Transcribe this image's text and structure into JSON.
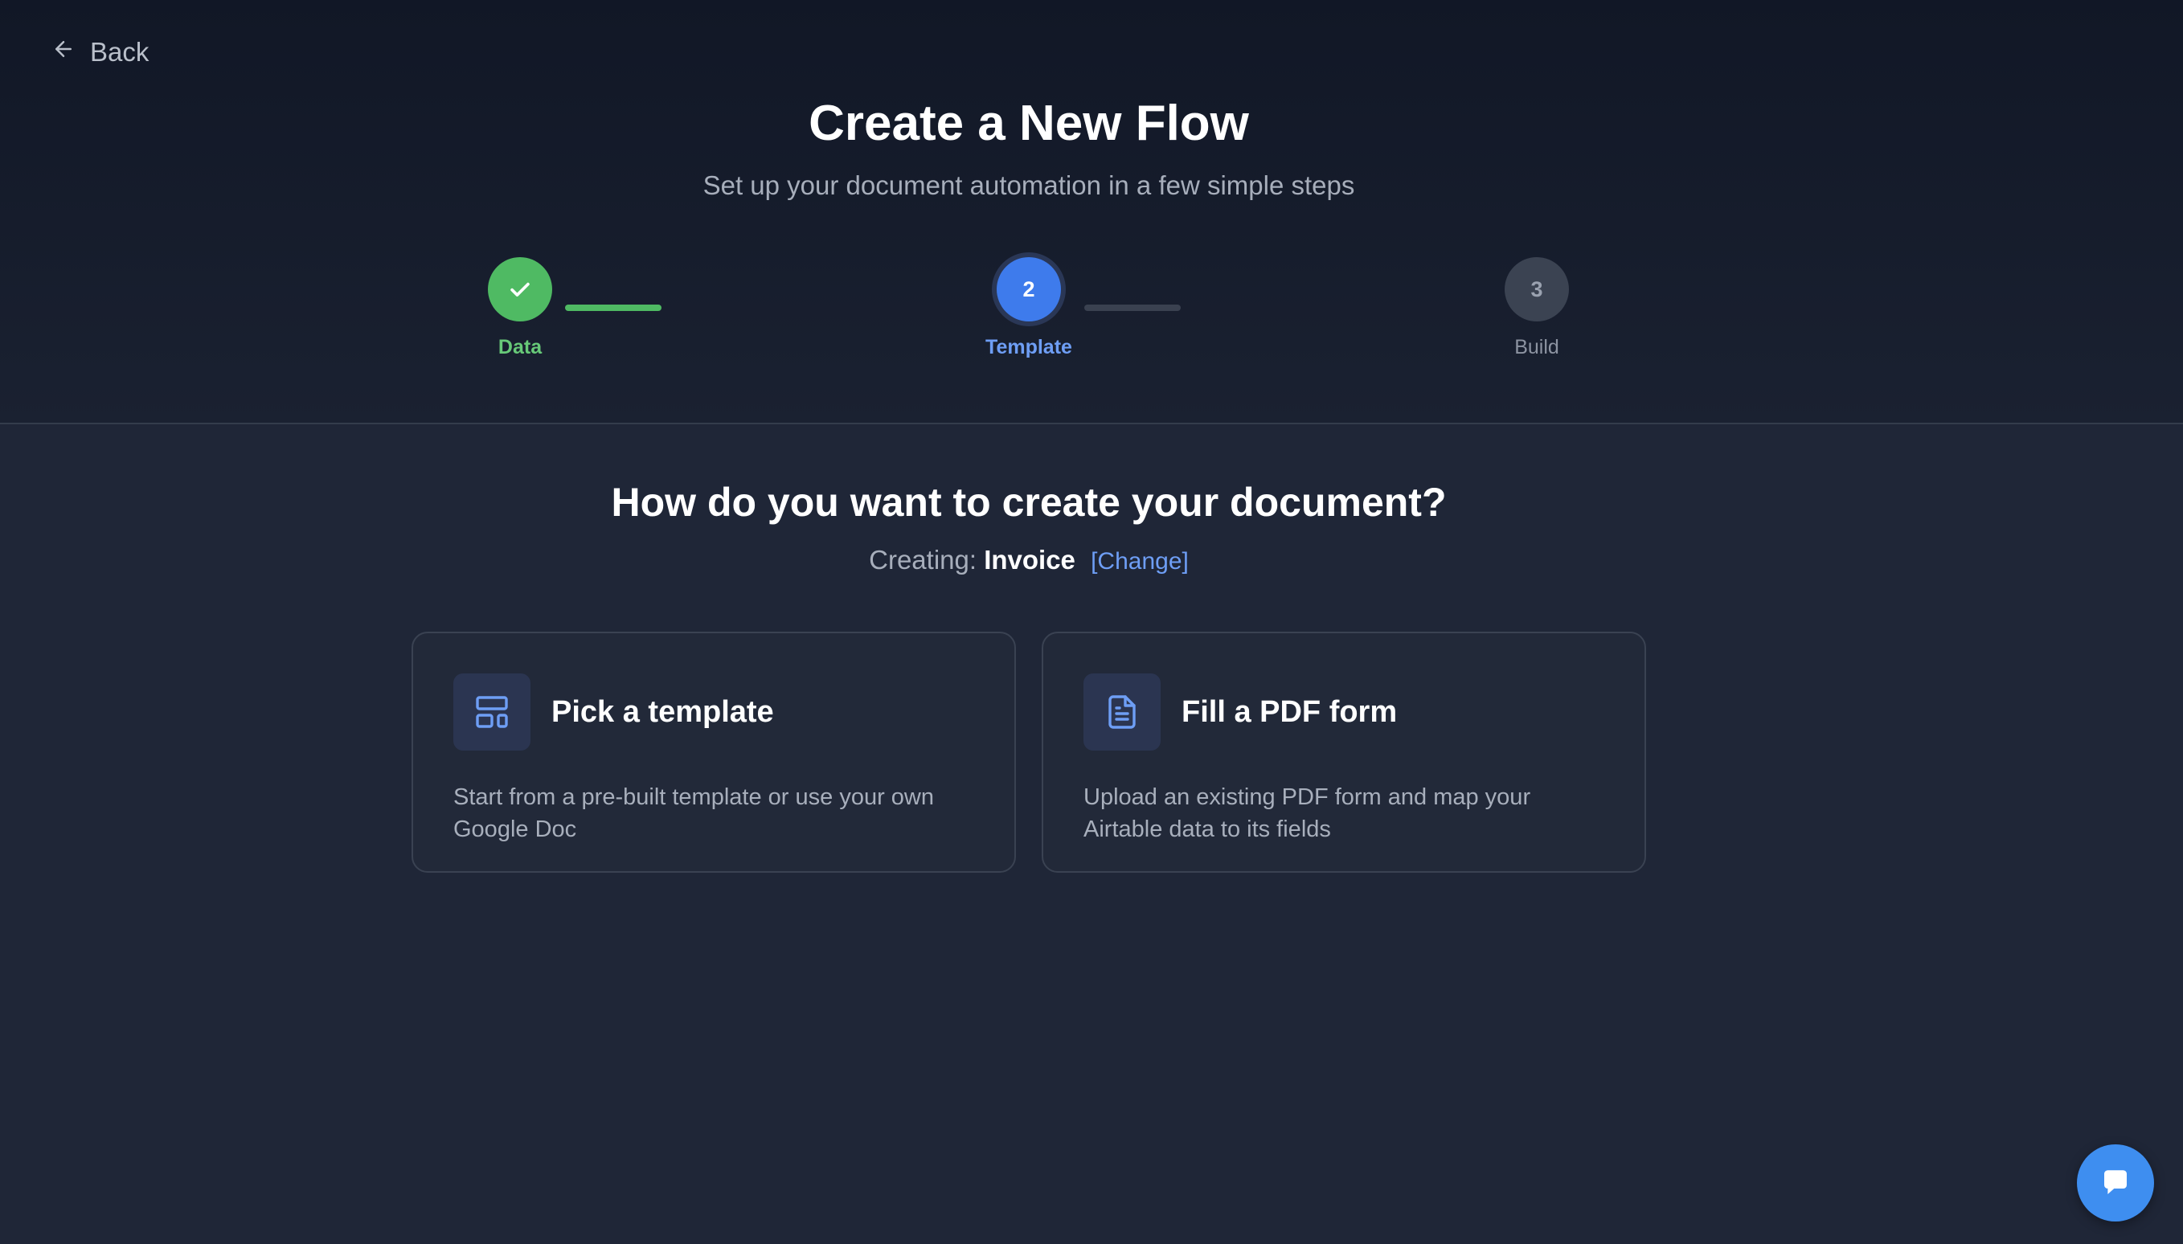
{
  "nav": {
    "back_label": "Back"
  },
  "header": {
    "title": "Create a New Flow",
    "subtitle": "Set up your document automation in a few simple steps"
  },
  "steps": [
    {
      "number": "1",
      "label": "Data",
      "status": "complete"
    },
    {
      "number": "2",
      "label": "Template",
      "status": "active"
    },
    {
      "number": "3",
      "label": "Build",
      "status": "pending"
    }
  ],
  "main": {
    "question": "How do you want to create your document?",
    "creating_prefix": "Creating:",
    "creating_value": "Invoice",
    "change_label": "[Change]"
  },
  "options": [
    {
      "title": "Pick a template",
      "description": "Start from a pre-built template or use your own Google Doc",
      "icon": "layout-template-icon"
    },
    {
      "title": "Fill a PDF form",
      "description": "Upload an existing PDF form and map your Airtable data to its fields",
      "icon": "file-text-icon"
    }
  ],
  "colors": {
    "background": "#1f2637",
    "header_background": "#111726",
    "accent_blue": "#3e7bec",
    "success_green": "#4fba63",
    "link_blue": "#6e9ef5",
    "chat_button": "#3e8ef0"
  },
  "chat": {
    "icon": "chat-bubble-icon"
  }
}
